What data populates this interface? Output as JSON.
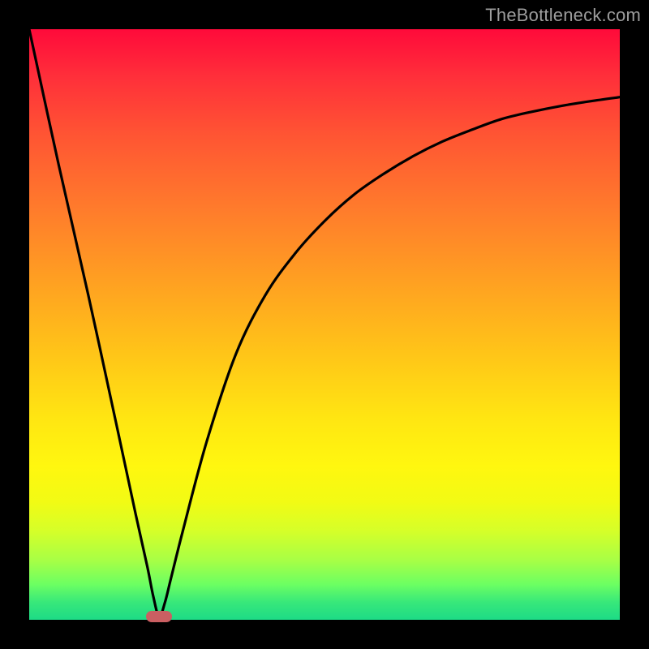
{
  "watermark": "TheBottleneck.com",
  "colors": {
    "frame": "#000000",
    "curve": "#000000",
    "marker": "#cb5f62",
    "gradient_stops": [
      "#ff0a3a",
      "#ff2f3a",
      "#ff5533",
      "#ff7a2c",
      "#ff9e22",
      "#ffc518",
      "#ffe612",
      "#fff70f",
      "#f2fb14",
      "#d5ff29",
      "#a7ff46",
      "#6cff62",
      "#38e87a",
      "#1ddb86"
    ]
  },
  "chart_data": {
    "type": "line",
    "title": "",
    "xlabel": "",
    "ylabel": "",
    "xlim": [
      0,
      100
    ],
    "ylim": [
      0,
      100
    ],
    "note": "Axis values are relative percentages read from the figure (no tick labels are drawn). The curve touches y≈0 near x≈22, rises steeply on both sides; the left branch reaches y≈100 at x≈0 and the right branch approaches y≈88 at x≈100 with a diminishing slope.",
    "series": [
      {
        "name": "curve",
        "x": [
          0,
          5,
          10,
          15,
          18,
          20,
          21,
          22,
          23,
          24,
          26,
          30,
          35,
          40,
          45,
          50,
          55,
          60,
          65,
          70,
          75,
          80,
          85,
          90,
          95,
          100
        ],
        "y": [
          100,
          77,
          55,
          32,
          18,
          9,
          4,
          0.5,
          3,
          7,
          15,
          30,
          45,
          55,
          62,
          67.5,
          72,
          75.5,
          78.5,
          81,
          83,
          84.8,
          86,
          87,
          87.8,
          88.5
        ]
      }
    ],
    "marker": {
      "x": 22,
      "y": 0.5
    },
    "background_gradient_direction": "top_red_to_bottom_green"
  }
}
